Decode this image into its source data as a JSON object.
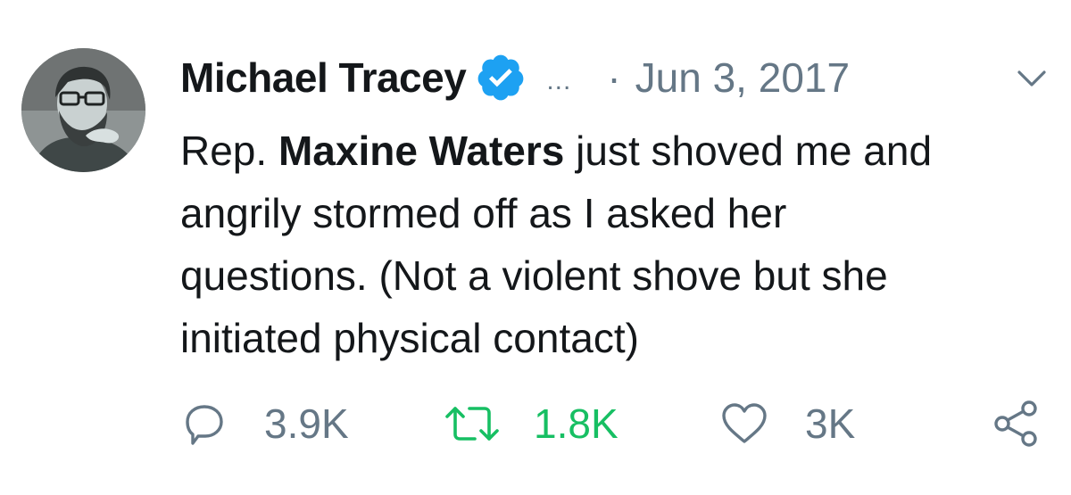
{
  "tweet": {
    "author": {
      "display_name": "Michael Tracey",
      "verified": true
    },
    "more_label": "...",
    "separator": "·",
    "date": "Jun 3, 2017",
    "body": {
      "line1_prefix": "Rep. ",
      "line1_bold": "Maxine Waters",
      "line1_suffix": " just shoved me and",
      "line2": "angrily stormed off as I asked her",
      "line3": "questions. (Not a violent shove but she",
      "line4": "initiated physical contact)"
    },
    "actions": {
      "reply": {
        "icon": "reply-icon",
        "count": "3.9K"
      },
      "retweet": {
        "icon": "retweet-icon",
        "count": "1.8K",
        "active": true
      },
      "like": {
        "icon": "heart-icon",
        "count": "3K"
      },
      "share": {
        "icon": "share-icon"
      }
    }
  },
  "colors": {
    "text_primary": "#14171a",
    "text_secondary": "#657786",
    "verified_blue": "#1da1f2",
    "retweet_green": "#17bf63"
  }
}
